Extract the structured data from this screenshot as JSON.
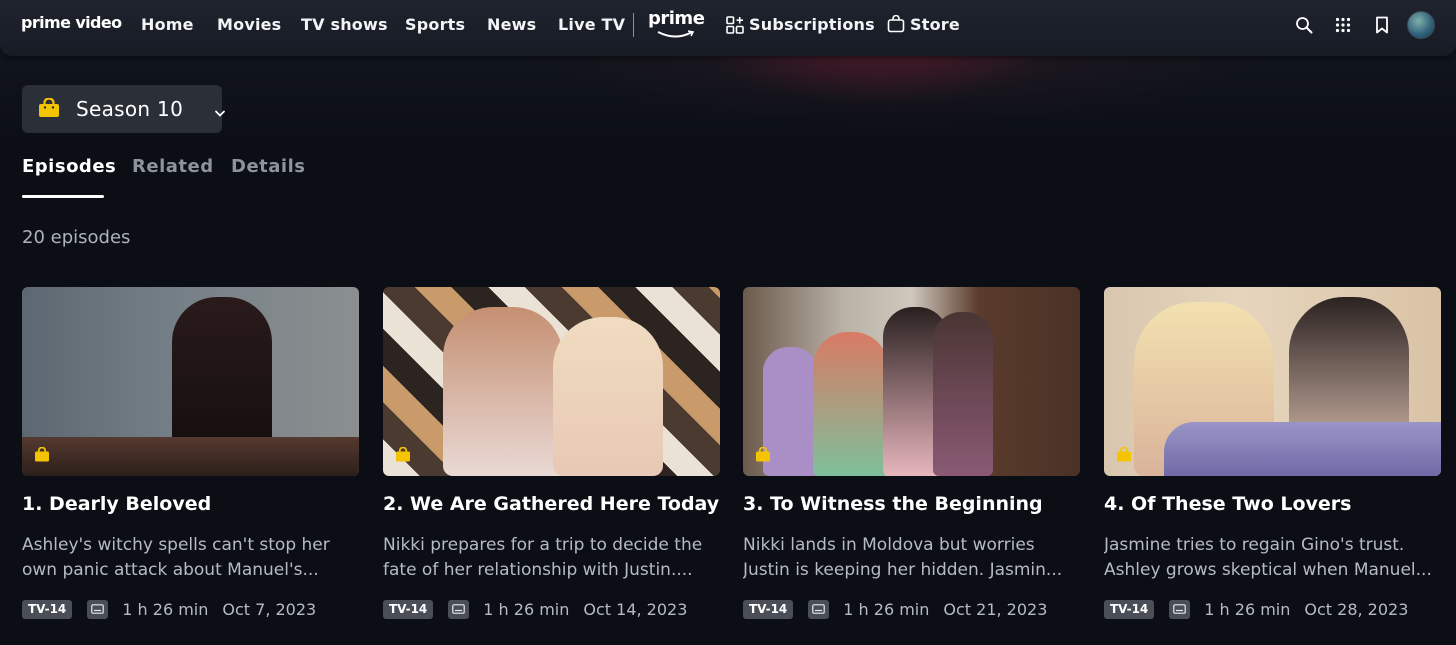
{
  "nav": {
    "logo": "prime video",
    "links": [
      "Home",
      "Movies",
      "TV shows",
      "Sports",
      "News",
      "Live TV"
    ],
    "prime_label": "prime",
    "subscriptions": "Subscriptions",
    "store": "Store",
    "icons": [
      "search-icon",
      "apps-grid-icon",
      "watchlist-bookmark-icon",
      "profile-avatar"
    ]
  },
  "season_selector": {
    "label": "Season 10",
    "icon": "shopping-bag-icon",
    "accent": "#f5c400"
  },
  "tabs": [
    {
      "label": "Episodes",
      "active": true
    },
    {
      "label": "Related",
      "active": false
    },
    {
      "label": "Details",
      "active": false
    }
  ],
  "episode_count": "20 episodes",
  "episodes": [
    {
      "title": "1. Dearly Beloved",
      "description": "Ashley's witchy spells can't stop her own panic attack about Manuel's...",
      "rating": "TV-14",
      "duration": "1 h 26 min",
      "date": "Oct 7, 2023"
    },
    {
      "title": "2. We Are Gathered Here Today",
      "description": "Nikki prepares for a trip to decide the fate of her relationship with Justin....",
      "rating": "TV-14",
      "duration": "1 h 26 min",
      "date": "Oct 14, 2023"
    },
    {
      "title": "3. To Witness the Beginning",
      "description": "Nikki lands in Moldova but worries Justin is keeping her hidden. Jasmin...",
      "rating": "TV-14",
      "duration": "1 h 26 min",
      "date": "Oct 21, 2023"
    },
    {
      "title": "4. Of These Two Lovers",
      "description": "Jasmine tries to regain Gino's trust. Ashley grows skeptical when Manuel...",
      "rating": "TV-14",
      "duration": "1 h 26 min",
      "date": "Oct 28, 2023"
    }
  ]
}
